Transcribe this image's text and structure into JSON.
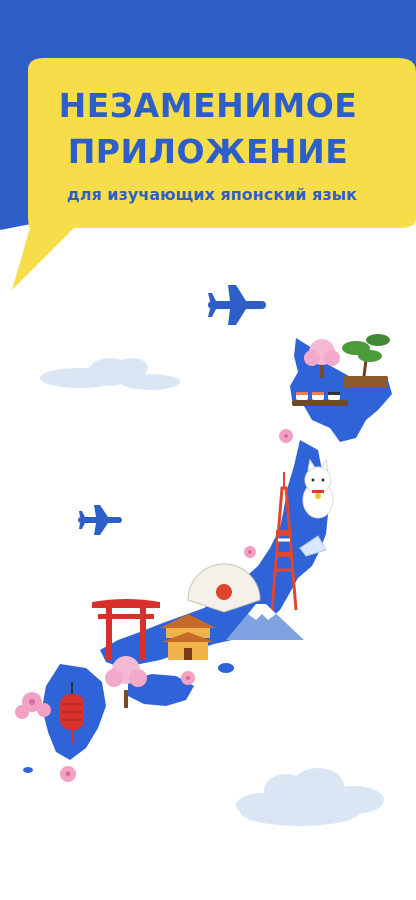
{
  "banner": {
    "title_line1": "НЕЗАМЕНИМОЕ",
    "title_line2": "ПРИЛОЖЕНИЕ",
    "subtitle": "для изучающих японский язык"
  },
  "icons": [
    "airplane-icon",
    "cloud-icon",
    "japan-map",
    "sakura-tree-icon",
    "bonsai-icon",
    "sushi-icon",
    "maneki-neko-icon",
    "tokyo-tower-icon",
    "torii-gate-icon",
    "fan-icon",
    "temple-icon",
    "mount-fuji-icon",
    "lantern-icon",
    "sakura-flower-icon"
  ],
  "colors": {
    "brand_blue": "#2e5fc9",
    "banner_yellow": "#f7dd4a",
    "map_blue": "#2f63d8"
  }
}
